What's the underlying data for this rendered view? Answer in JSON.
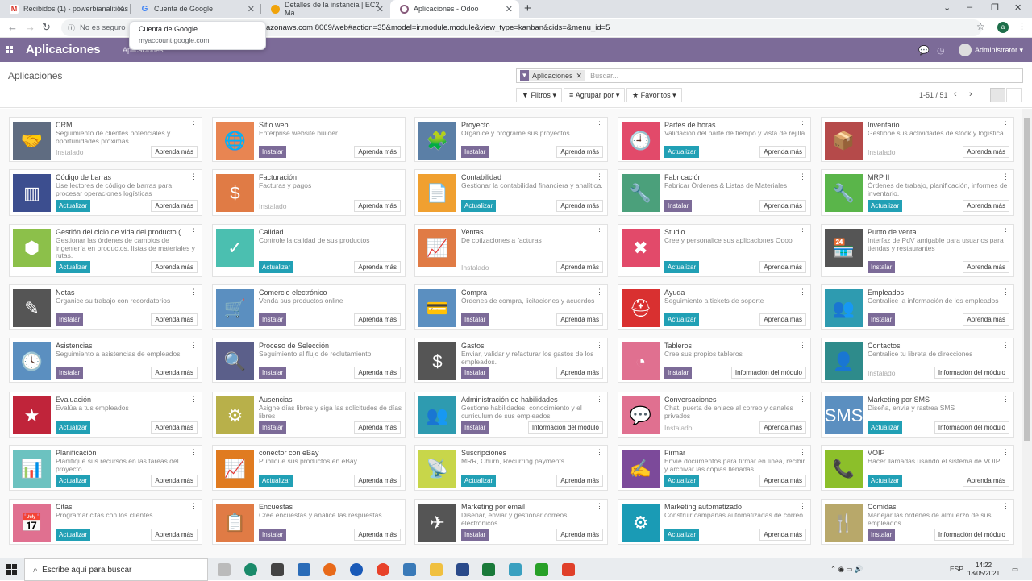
{
  "browser": {
    "tabs": [
      {
        "label": "Recibidos (1) - powerbianaliticas",
        "favicon": "gmail-icon",
        "color": "#d93025"
      },
      {
        "label": "Cuenta de Google",
        "favicon": "google-icon",
        "color": "#4285f4"
      },
      {
        "label": "Detalles de la instancia | EC2 Ma",
        "favicon": "aws-icon",
        "color": "#f0a30a"
      },
      {
        "label": "Aplicaciones - Odoo",
        "favicon": "odoo-icon",
        "color": "#875a7b"
      }
    ],
    "security": "No es seguro",
    "url": "azonaws.com:8069/web#action=35&model=ir.module.module&view_type=kanban&cids=&menu_id=5",
    "profile_initial": "a",
    "tooltip": {
      "title": "Cuenta de Google",
      "subtitle": "myaccount.google.com"
    }
  },
  "navbar": {
    "brand": "Aplicaciones",
    "menu": "Aplicaciones",
    "user": "Administrator"
  },
  "control": {
    "title": "Aplicaciones",
    "facet": "Aplicaciones",
    "search_placeholder": "Buscar...",
    "filters": "Filtros",
    "group": "Agrupar por",
    "favorites": "Favoritos",
    "pager": "1-51 / 51"
  },
  "apps": [
    {
      "name": "CRM",
      "desc": "Seguimiento de clientes potenciales y oportunidades próximas",
      "status": "Instalado",
      "btn": "Aprenda más",
      "color": "#5f6c81",
      "icon": "handshake-icon",
      "glyph": "🤝"
    },
    {
      "name": "Sitio web",
      "desc": "Enterprise website builder",
      "status": "Instalar",
      "btn": "Aprenda más",
      "color": "#e88552",
      "icon": "globe-icon",
      "glyph": "🌐"
    },
    {
      "name": "Proyecto",
      "desc": "Organice y programe sus proyectos",
      "status": "Instalar",
      "btn": "Aprenda más",
      "color": "#5b7fa6",
      "icon": "puzzle-icon",
      "glyph": "🧩"
    },
    {
      "name": "Partes de horas",
      "desc": "Validación del parte de tiempo y vista de rejilla",
      "status": "Actualizar",
      "btn": "Aprenda más",
      "color": "#e24a6a",
      "icon": "clock-icon",
      "glyph": "🕘"
    },
    {
      "name": "Inventario",
      "desc": "Gestione sus actividades de stock y logística",
      "status": "Instalado",
      "btn": "Aprenda más",
      "color": "#b54a4a",
      "icon": "box-icon",
      "glyph": "📦"
    },
    {
      "name": "Código de barras",
      "desc": "Use lectores de código de barras para procesar operaciones logísticas",
      "status": "Actualizar",
      "btn": "Aprenda más",
      "color": "#3c4e8f",
      "icon": "barcode-icon",
      "glyph": "▥"
    },
    {
      "name": "Facturación",
      "desc": "Facturas y pagos",
      "status": "Instalado",
      "btn": "Aprenda más",
      "color": "#e07b45",
      "icon": "invoice-icon",
      "glyph": "$"
    },
    {
      "name": "Contabilidad",
      "desc": "Gestionar la contabilidad financiera y analítica.",
      "status": "Actualizar",
      "btn": "Aprenda más",
      "color": "#f0a030",
      "icon": "document-icon",
      "glyph": "📄"
    },
    {
      "name": "Fabricación",
      "desc": "Fabricar Órdenes & Listas de Materiales",
      "status": "Instalar",
      "btn": "Aprenda más",
      "color": "#4ba07b",
      "icon": "wrench-icon",
      "glyph": "🔧"
    },
    {
      "name": "MRP II",
      "desc": "Órdenes de trabajo, planificación, informes de inventario.",
      "status": "Actualizar",
      "btn": "Aprenda más",
      "color": "#5ab54a",
      "icon": "wrench-icon",
      "glyph": "🔧"
    },
    {
      "name": "Gestión del ciclo de vida del producto (...",
      "desc": "Gestionar las órdenes de cambios de ingeniería en productos, listas de materiales y rutas.",
      "status": "Actualizar",
      "btn": "Aprenda más",
      "color": "#8cc04a",
      "icon": "cube-icon",
      "glyph": "⬢"
    },
    {
      "name": "Calidad",
      "desc": "Controle la calidad de sus productos",
      "status": "Actualizar",
      "btn": "Aprenda más",
      "color": "#4bbfb0",
      "icon": "clipboard-check-icon",
      "glyph": "✓"
    },
    {
      "name": "Ventas",
      "desc": "De cotizaciones a facturas",
      "status": "Instalado",
      "btn": "Aprenda más",
      "color": "#e07b45",
      "icon": "chart-icon",
      "glyph": "📈"
    },
    {
      "name": "Studio",
      "desc": "Cree y personalice sus aplicaciones Odoo",
      "status": "Actualizar",
      "btn": "Aprenda más",
      "color": "#e24a6a",
      "icon": "tools-icon",
      "glyph": "✖"
    },
    {
      "name": "Punto de venta",
      "desc": "Interfaz de PdV amigable para usuarios para tiendas y restaurantes",
      "status": "Instalar",
      "btn": "Aprenda más",
      "color": "#555555",
      "icon": "store-icon",
      "glyph": "🏪"
    },
    {
      "name": "Notas",
      "desc": "Organice su trabajo con recordatorios",
      "status": "Instalar",
      "btn": "Aprenda más",
      "color": "#555555",
      "icon": "note-icon",
      "glyph": "✎"
    },
    {
      "name": "Comercio electrónico",
      "desc": "Venda sus productos online",
      "status": "Instalar",
      "btn": "Aprenda más",
      "color": "#5b8fc0",
      "icon": "cart-icon",
      "glyph": "🛒"
    },
    {
      "name": "Compra",
      "desc": "Órdenes de compra, licitaciones y acuerdos",
      "status": "Instalar",
      "btn": "Aprenda más",
      "color": "#5b8fc0",
      "icon": "credit-card-icon",
      "glyph": "💳"
    },
    {
      "name": "Ayuda",
      "desc": "Seguimiento a tickets de soporte",
      "status": "Actualizar",
      "btn": "Aprenda más",
      "color": "#d93030",
      "icon": "lifebuoy-icon",
      "glyph": "⛑"
    },
    {
      "name": "Empleados",
      "desc": "Centralice la información de los empleados",
      "status": "Instalar",
      "btn": "Aprenda más",
      "color": "#2e9bb0",
      "icon": "people-icon",
      "glyph": "👥"
    },
    {
      "name": "Asistencias",
      "desc": "Seguimiento a asistencias de empleados",
      "status": "Instalar",
      "btn": "Aprenda más",
      "color": "#5b8fc0",
      "icon": "user-clock-icon",
      "glyph": "🕓"
    },
    {
      "name": "Proceso de Selección",
      "desc": "Seguimiento al flujo de reclutamiento",
      "status": "Instalar",
      "btn": "Aprenda más",
      "color": "#5b5f8a",
      "icon": "magnifier-icon",
      "glyph": "🔍"
    },
    {
      "name": "Gastos",
      "desc": "Enviar, validar y refacturar los gastos de los empleados.",
      "status": "Instalar",
      "btn": "Aprenda más",
      "color": "#555555",
      "icon": "expense-icon",
      "glyph": "$"
    },
    {
      "name": "Tableros",
      "desc": "Cree sus propios tableros",
      "status": "Instalar",
      "btn": "Información del módulo",
      "color": "#e07090",
      "icon": "gauge-icon",
      "glyph": "◔"
    },
    {
      "name": "Contactos",
      "desc": "Centralice tu libreta de direcciones",
      "status": "Instalado",
      "btn": "Información del módulo",
      "color": "#2e8b8b",
      "icon": "contact-card-icon",
      "glyph": "👤"
    },
    {
      "name": "Evaluación",
      "desc": "Evalúa a tus empleados",
      "status": "Actualizar",
      "btn": "Aprenda más",
      "color": "#c0243a",
      "icon": "star-icon",
      "glyph": "★"
    },
    {
      "name": "Ausencias",
      "desc": "Asigne días libres y siga las solicitudes de días libres",
      "status": "Instalar",
      "btn": "Aprenda más",
      "color": "#b8b04a",
      "icon": "user-gear-icon",
      "glyph": "⚙"
    },
    {
      "name": "Administración de habilidades",
      "desc": "Gestione habilidades, conocimiento y el curriculum de sus empleados",
      "status": "Instalar",
      "btn": "Información del módulo",
      "color": "#2e9bb0",
      "icon": "people-icon",
      "glyph": "👥"
    },
    {
      "name": "Conversaciones",
      "desc": "Chat, puerta de enlace al correo y canales privados",
      "status": "Instalado",
      "btn": "Aprenda más",
      "color": "#e07090",
      "icon": "chat-icon",
      "glyph": "💬"
    },
    {
      "name": "Marketing por SMS",
      "desc": "Diseña, envía y rastrea SMS",
      "status": "Actualizar",
      "btn": "Información del módulo",
      "color": "#5b8fc0",
      "icon": "sms-icon",
      "glyph": "SMS"
    },
    {
      "name": "Planificación",
      "desc": "Planifique sus recursos en las tareas del proyecto",
      "status": "Actualizar",
      "btn": "Aprenda más",
      "color": "#6cc2c0",
      "icon": "bar-chart-icon",
      "glyph": "📊"
    },
    {
      "name": "conector con eBay",
      "desc": "Publique sus productos en eBay",
      "status": "Actualizar",
      "btn": "Aprenda más",
      "color": "#e07b20",
      "icon": "trend-icon",
      "glyph": "📈"
    },
    {
      "name": "Suscripciones",
      "desc": "MRR, Churn, Recurring payments",
      "status": "Actualizar",
      "btn": "Aprenda más",
      "color": "#c8d64a",
      "icon": "rss-icon",
      "glyph": "📡"
    },
    {
      "name": "Firmar",
      "desc": "Envíe documentos para firmar en línea, recibir y archivar las copias llenadas",
      "status": "Actualizar",
      "btn": "Aprenda más",
      "color": "#7c4a9a",
      "icon": "sign-icon",
      "glyph": "✍"
    },
    {
      "name": "VOIP",
      "desc": "Hacer llamadas usando el sistema de VOIP",
      "status": "Actualizar",
      "btn": "Aprenda más",
      "color": "#8cbf2a",
      "icon": "phone-icon",
      "glyph": "📞"
    },
    {
      "name": "Citas",
      "desc": "Programar citas con los clientes.",
      "status": "Actualizar",
      "btn": "Aprenda más",
      "color": "#e07090",
      "icon": "calendar-icon",
      "glyph": "📅"
    },
    {
      "name": "Encuestas",
      "desc": "Cree encuestas y analice las respuestas",
      "status": "Instalar",
      "btn": "Aprenda más",
      "color": "#e07b45",
      "icon": "survey-icon",
      "glyph": "📋"
    },
    {
      "name": "Marketing por email",
      "desc": "Diseñar, enviar y gestionar correos electrónicos",
      "status": "Instalar",
      "btn": "Aprenda más",
      "color": "#555555",
      "icon": "paper-plane-icon",
      "glyph": "✈"
    },
    {
      "name": "Marketing automatizado",
      "desc": "Construir campañas automatizadas de correo",
      "status": "Actualizar",
      "btn": "Aprenda más",
      "color": "#1a9bb5",
      "icon": "gear-mail-icon",
      "glyph": "⚙"
    },
    {
      "name": "Comidas",
      "desc": "Manejar las órdenes de almuerzo de sus empleados.",
      "status": "Instalar",
      "btn": "Información del módulo",
      "color": "#b8a86a",
      "icon": "cutlery-icon",
      "glyph": "🍴"
    }
  ],
  "taskbar": {
    "search": "Escribe aquí para buscar",
    "lang": "ESP",
    "time": "14:22",
    "date": "18/05/2021"
  }
}
